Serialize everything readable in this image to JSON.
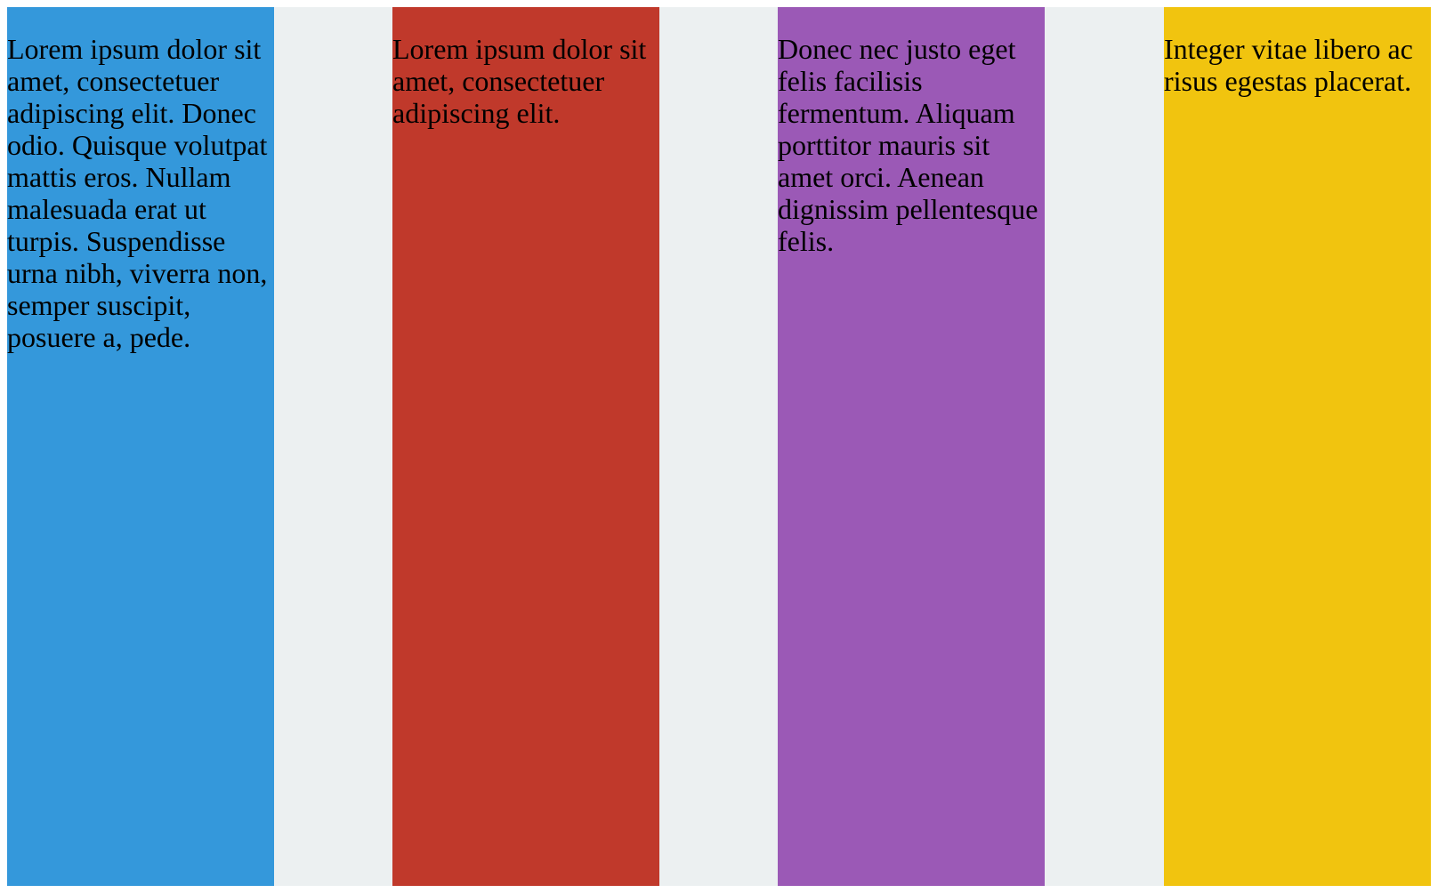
{
  "page": {
    "background": "#ecf0f1"
  },
  "columns": [
    {
      "color": "#3498db",
      "text": "Lorem ipsum dolor sit amet, consectetuer adipiscing elit. Donec odio. Quisque volutpat mattis eros. Nullam malesuada erat ut turpis. Suspendisse urna nibh, viverra non, semper suscipit, posuere a, pede."
    },
    {
      "color": "#c0392b",
      "text": "Lorem ipsum dolor sit amet, consectetuer adipiscing elit."
    },
    {
      "color": "#9b59b6",
      "text": "Donec nec justo eget felis facilisis fermentum. Aliquam porttitor mauris sit amet orci. Aenean dignissim pellentesque felis."
    },
    {
      "color": "#f1c40f",
      "text": "Integer vitae libero ac risus egestas placerat."
    }
  ]
}
